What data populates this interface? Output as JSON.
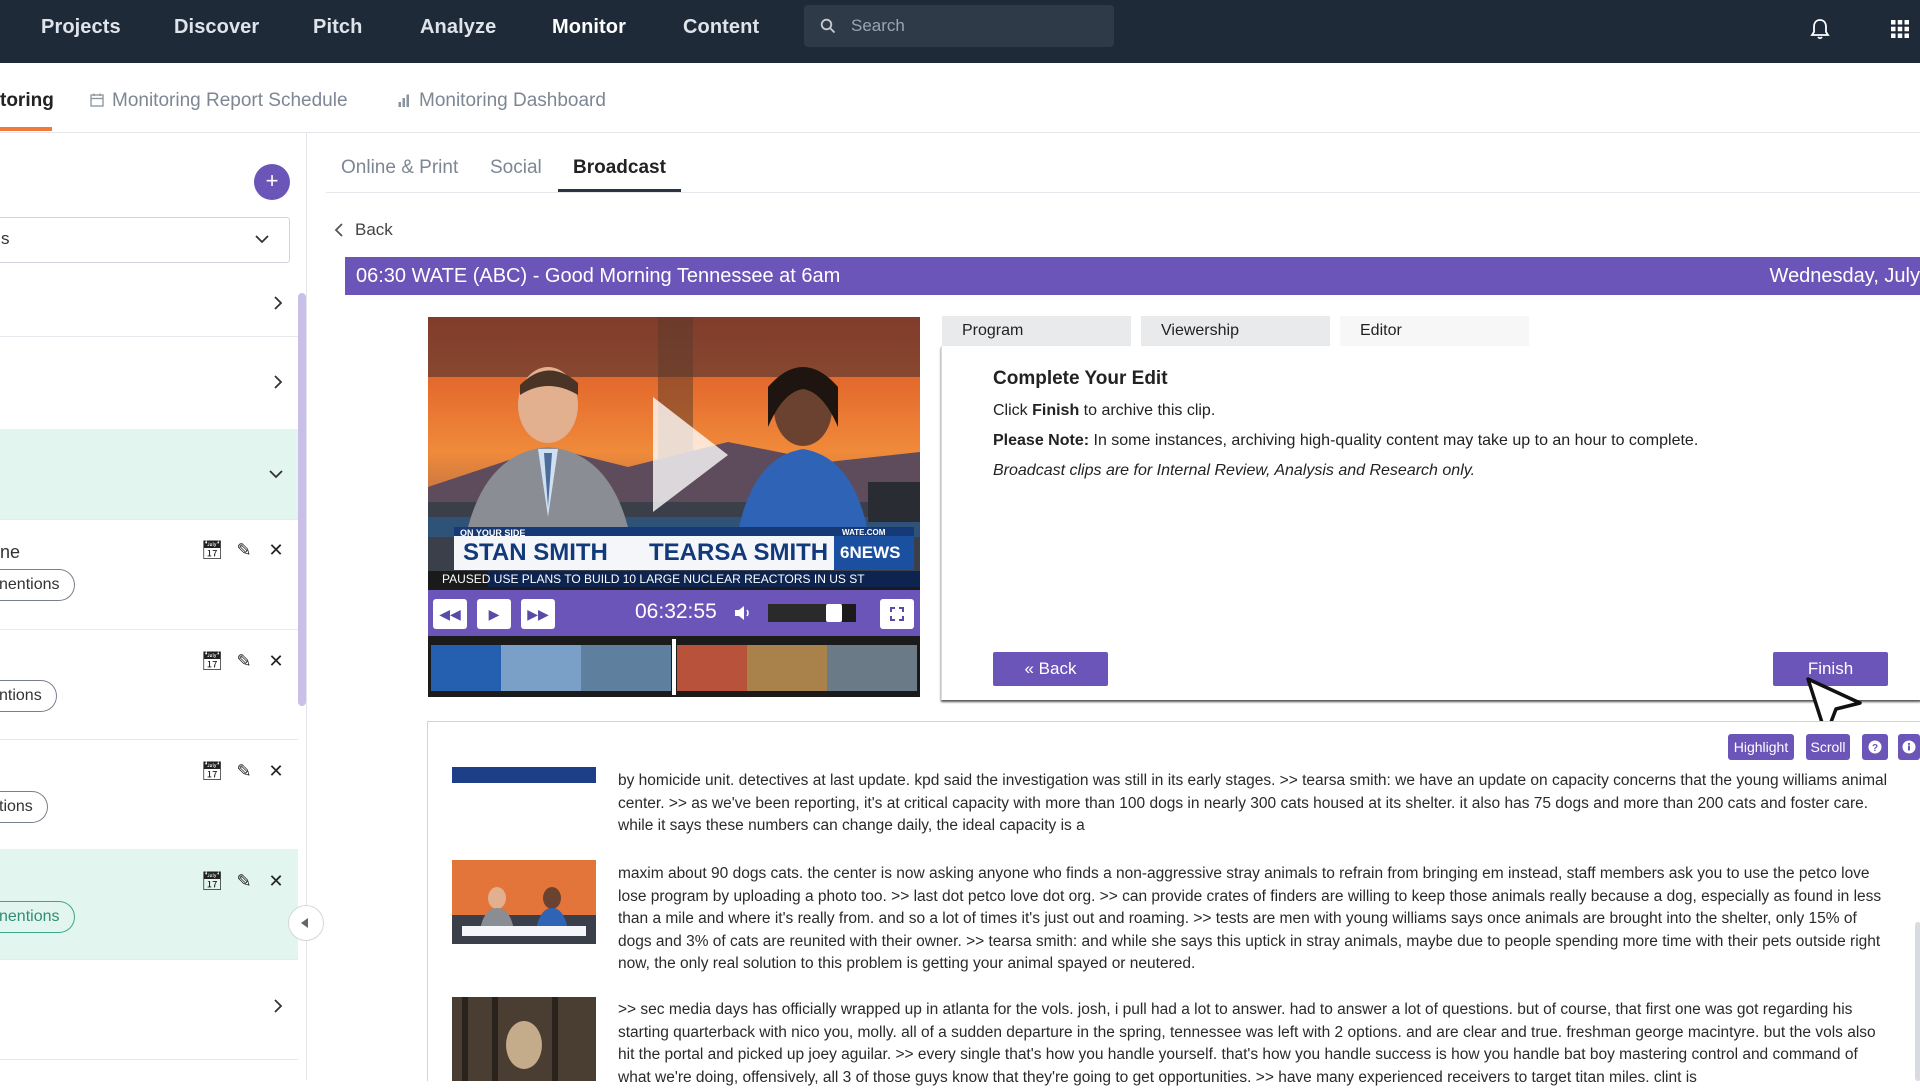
{
  "topnav": {
    "items": [
      "Projects",
      "Discover",
      "Pitch",
      "Analyze",
      "Monitor",
      "Content"
    ],
    "active": "Monitor",
    "search_placeholder": "Search"
  },
  "subnav": {
    "current_tab": "toring",
    "report_schedule": "Monitoring Report Schedule",
    "dashboard": "Monitoring Dashboard"
  },
  "leftpanel": {
    "dropdown_value": "s",
    "items": [
      {
        "name": "ne",
        "pill": "nentions"
      },
      {
        "pill": "ntions"
      },
      {
        "pill": "tions"
      },
      {
        "pill": "nentions"
      }
    ]
  },
  "main_tabs": [
    "Online & Print",
    "Social",
    "Broadcast"
  ],
  "main_tab_active": "Broadcast",
  "back_label": "Back",
  "clip": {
    "title": "06:30 WATE (ABC) - Good Morning Tennessee at 6am",
    "date": "Wednesday, July"
  },
  "video": {
    "lower_third_top": "ON YOUR SIDE",
    "name_left": "STAN SMITH",
    "name_right": "TEARSA SMITH",
    "station_logo": "6NEWS",
    "station_url": "WATE.COM",
    "ticker": "PAUSED USE PLANS TO BUILD 10 LARGE NUCLEAR REACTORS IN US ST",
    "time": "06:32:55",
    "volume": 0.8
  },
  "editor": {
    "tabs": [
      "Program",
      "Viewership",
      "Editor"
    ],
    "active_tab": "Editor",
    "heading": "Complete Your Edit",
    "line1_pre": "Click ",
    "line1_bold": "Finish",
    "line1_post": " to archive this clip.",
    "note_bold": "Please Note:",
    "note_text": " In some instances, archiving high-quality content may take up to an hour to complete.",
    "disclaimer": "Broadcast clips are for Internal Review, Analysis and Research only.",
    "back_button": "« Back",
    "finish_button": "Finish"
  },
  "transcript": {
    "tools": [
      "Highlight",
      "Scroll"
    ],
    "paragraphs": [
      "by homicide unit. detectives at last update. kpd said the investigation was still in its early stages. >> tearsa smith: we have an update on capacity concerns that the young williams animal center. >> as we've been reporting, it's at critical capacity with more than 100 dogs in nearly 300 cats housed at its shelter. it also has 75 dogs and more than 200 cats and foster care. while it says these numbers can change daily, the ideal capacity is a",
      "maxim about 90 dogs cats. the center is now asking anyone who finds a non-aggressive stray animals to refrain from bringing em instead, staff members ask you to use the petco love lose program by uploading a photo too. >> last dot petco love dot org. >> can provide crates of finders are willing to keep those animals really because a dog, especially as found in less than a mile and where it's really from. and so a lot of times it's just out and roaming. >> tests are men with young williams says once animals are brought into the shelter, only 15% of dogs and 3% of cats are reunited with their owner. >> tearsa smith: and while she says this uptick in stray animals, maybe due to people spending more time with their pets outside right now, the only real solution to this problem is getting your animal spayed or neutered.",
      ">> sec media days has officially wrapped up in atlanta for the vols. josh, i pull had a lot to answer. had to answer a lot of questions. but of course, that first one was got regarding his starting quarterback with nico you, molly. all of a sudden departure in the spring, tennessee was left with 2 options. and are clear and true. freshman george macintyre. but the vols also hit the portal and picked up joey aguilar. >> every single that's how you handle yourself. that's how you handle success is how you handle bat boy mastering control and command of what we're doing, offensively, all 3 of those guys know that they're going to get opportunities. >> have many experienced receivers to target titan miles. clint is"
    ]
  }
}
